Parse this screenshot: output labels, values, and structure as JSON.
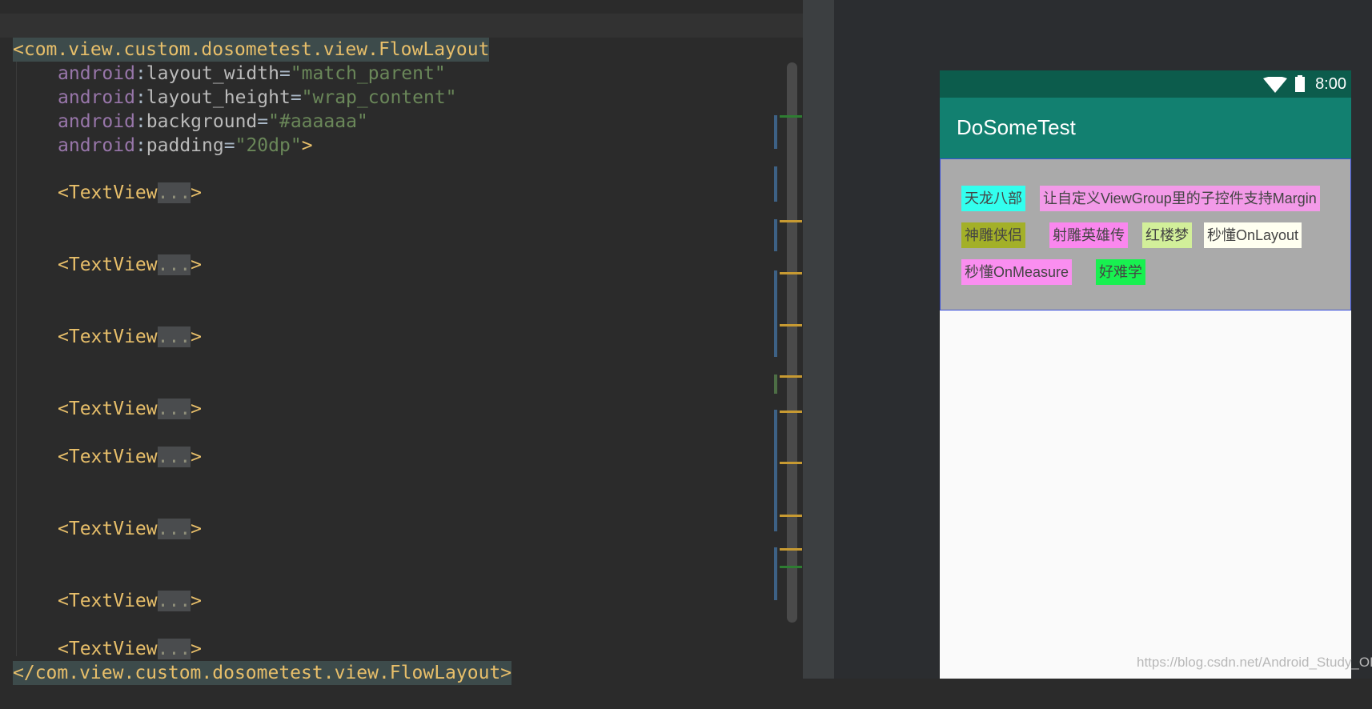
{
  "editor": {
    "lines": [
      {
        "tag": "<com.view.custom.dosometest.view.FlowLayout"
      },
      {
        "ns": "android",
        "attr": "layout_width",
        "value": "\"match_parent\""
      },
      {
        "ns": "android",
        "attr": "layout_height",
        "value": "\"wrap_content\""
      },
      {
        "ns": "android",
        "attr": "background",
        "value": "\"#aaaaaa\""
      },
      {
        "ns": "android",
        "attr": "padding",
        "value": "\"20dp\"",
        "close": ">"
      }
    ],
    "textview_open": "<TextView",
    "fold": "...",
    "textview_close": ">",
    "closing_tag": "</com.view.custom.dosometest.view.FlowLayout>",
    "colon": ":",
    "equals": "="
  },
  "device": {
    "time": "8:00",
    "wifi_icon": "wifi-icon",
    "battery_icon": "battery-icon",
    "app_title": "DoSomeTest",
    "flow_background": "#aaaaaa",
    "chips": [
      {
        "text": "天龙八部",
        "color": "#33ffee"
      },
      {
        "text": "让自定义ViewGroup里的子控件支持Margin",
        "color": "#f39ae8"
      },
      {
        "text": "神雕侠侣",
        "color": "#a3b028"
      },
      {
        "text": "射雕英雄传",
        "color": "#fa87ee"
      },
      {
        "text": "红楼梦",
        "color": "#d2ef9a"
      },
      {
        "text": "秒懂OnLayout",
        "color": "#fffff0"
      },
      {
        "text": "秒懂OnMeasure",
        "color": "#fa8ef0"
      },
      {
        "text": "好难学",
        "color": "#18f050"
      }
    ]
  },
  "watermark": "https://blog.csdn.net/Android_Study_OK"
}
